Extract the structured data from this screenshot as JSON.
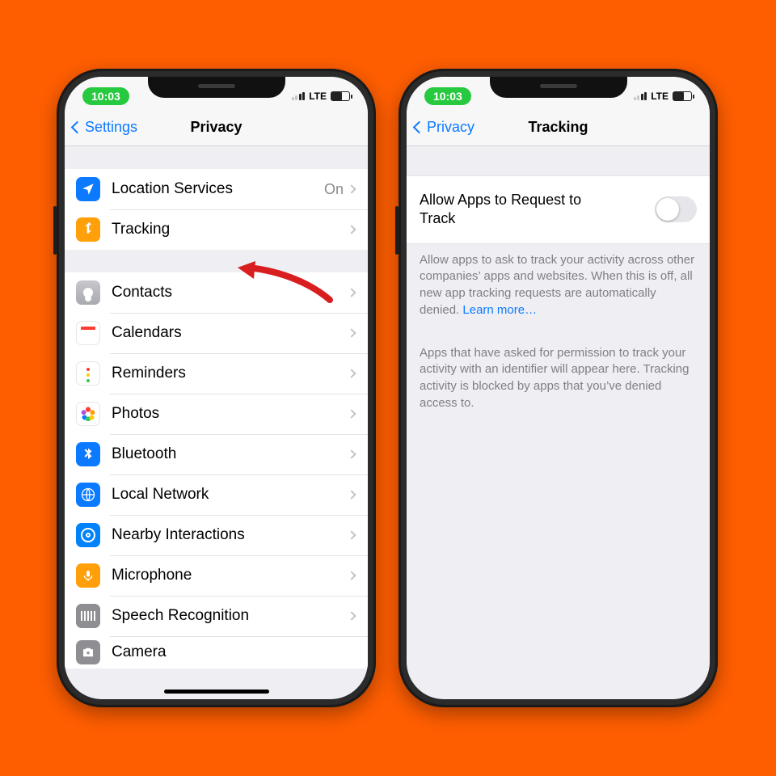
{
  "status": {
    "time": "10:03",
    "network_label": "LTE"
  },
  "phone1": {
    "back_label": "Settings",
    "title": "Privacy",
    "rows": [
      {
        "label": "Location Services",
        "detail": "On"
      },
      {
        "label": "Tracking"
      },
      {
        "label": "Contacts"
      },
      {
        "label": "Calendars"
      },
      {
        "label": "Reminders"
      },
      {
        "label": "Photos"
      },
      {
        "label": "Bluetooth"
      },
      {
        "label": "Local Network"
      },
      {
        "label": "Nearby Interactions"
      },
      {
        "label": "Microphone"
      },
      {
        "label": "Speech Recognition"
      },
      {
        "label": "Camera"
      }
    ]
  },
  "phone2": {
    "back_label": "Privacy",
    "title": "Tracking",
    "toggle_label": "Allow Apps to Request to Track",
    "toggle_on": false,
    "description": "Allow apps to ask to track your activity across other companies’ apps and websites. When this is off, all new app tracking requests are automatically denied.",
    "learn_more": "Learn more…",
    "apps_footer": "Apps that have asked for permission to track your activity with an identifier will appear here. Tracking activity is blocked by apps that you’ve denied access to."
  },
  "colors": {
    "background": "#FF5E00",
    "link": "#0b7aff"
  }
}
